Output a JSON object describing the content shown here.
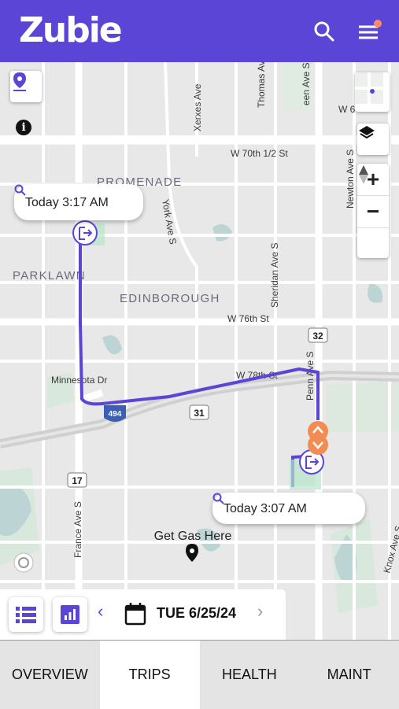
{
  "header": {
    "logo_text": "Zubie",
    "search_icon": "search-icon",
    "menu_icon": "menu-icon",
    "notification_color": "#ff8a65"
  },
  "colors": {
    "brand": "#5b45d6",
    "route": "#5b45d6",
    "orange_marker": "#f28c52"
  },
  "map": {
    "streets": [
      "Xerxes Ave",
      "Thomas Ave S",
      "een Ave S",
      "W 6",
      "W 70th 1/2 St",
      "York Ave S",
      "Newton Ave S",
      "Sheridan Ave S",
      "W 76th St",
      "Minnesota Dr",
      "W 78th St",
      "Penn Ave S",
      "France Ave S",
      "Knox Ave S"
    ],
    "areas": [
      "PROMENADE",
      "PARKLAWN",
      "EDINBOROUGH"
    ],
    "highway_shields": [
      "32",
      "31",
      "17",
      "494"
    ],
    "poi": "Get Gas Here",
    "start_bubble": "Today 3:17 AM",
    "end_bubble": "Today 3:07 AM"
  },
  "toolbar": {
    "date_label": "TUE 6/25/24",
    "prev": "‹",
    "next": "›"
  },
  "tabs": [
    "OVERVIEW",
    "TRIPS",
    "HEALTH",
    "MAINT"
  ],
  "active_tab": "TRIPS"
}
